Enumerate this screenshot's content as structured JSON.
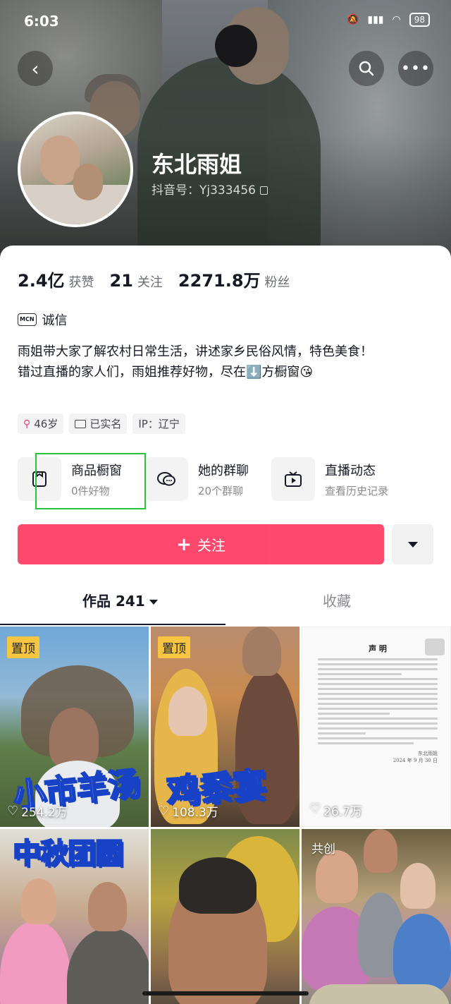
{
  "status_bar": {
    "time": "6:03",
    "battery": "98"
  },
  "profile": {
    "name": "东北雨姐",
    "douyin_id": "抖音号：Yj333456"
  },
  "stats": {
    "likes_num": "2.4亿",
    "likes_label": "获赞",
    "following_num": "21",
    "following_label": "关注",
    "fans_num": "2271.8万",
    "fans_label": "粉丝"
  },
  "mcn": {
    "badge": "MCN",
    "label": "诚信"
  },
  "bio": {
    "line1": "雨姐带大家了解农村日常生活，讲述家乡民俗风情，特色美食！",
    "line2": "错过直播的家人们，雨姐推荐好物，尽在⬇️方橱窗😘"
  },
  "tags": [
    {
      "icon": "female-icon",
      "label": "46岁"
    },
    {
      "icon": "id-card-icon",
      "label": "已实名"
    },
    {
      "icon": "",
      "label": "IP：辽宁"
    }
  ],
  "services": [
    {
      "icon": "shop-window-icon",
      "title": "商品橱窗",
      "sub": "0件好物"
    },
    {
      "icon": "group-chat-icon",
      "title": "她的群聊",
      "sub": "20个群聊"
    },
    {
      "icon": "live-tv-icon",
      "title": "直播动态",
      "sub": "查看历史记录"
    }
  ],
  "follow_button": {
    "plus": "+",
    "label": "关注"
  },
  "tabs": {
    "works": "作品 241",
    "favorites": "收藏"
  },
  "videos": [
    {
      "badge": "置顶",
      "cover_text": "小市羊汤",
      "likes": "254.2万"
    },
    {
      "badge": "置顶",
      "cover_text": "鸡黍宴",
      "likes": "108.3万"
    },
    {
      "badge": "",
      "doc_title": "声 明",
      "doc_sign": "东北雨姐",
      "doc_date": "2024 年 9 月 30 日",
      "likes": "26.7万"
    },
    {
      "badge": "",
      "cover_text": "中秋团圆",
      "likes": ""
    },
    {
      "badge": "",
      "likes": ""
    },
    {
      "badge": "共创",
      "likes": ""
    }
  ],
  "colors": {
    "accent": "#fe2c55",
    "pin": "#f7c541",
    "highlight": "#28c43c"
  }
}
